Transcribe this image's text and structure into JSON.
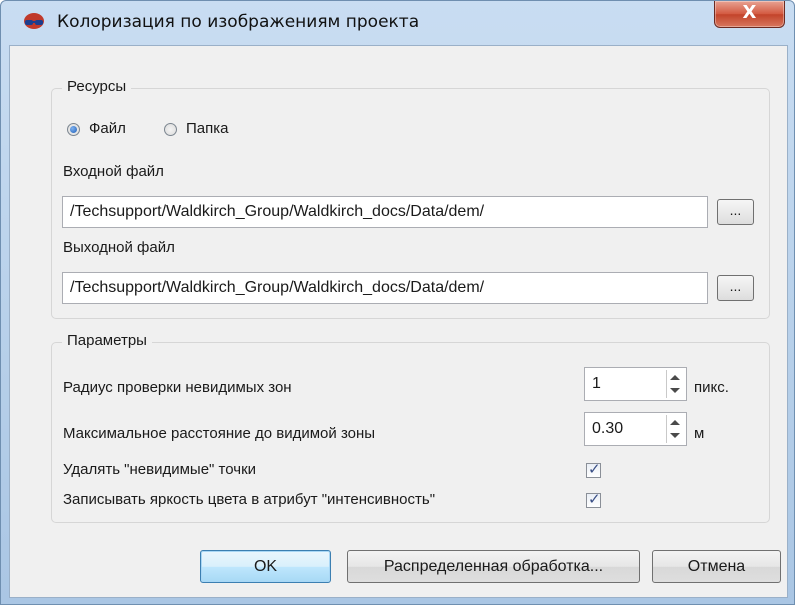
{
  "window": {
    "title": "Колоризация по изображениям проекта",
    "close_label": "X"
  },
  "resources": {
    "group_title": "Ресурсы",
    "radio_file_label": "Файл",
    "radio_folder_label": "Папка",
    "radio_selected": "file",
    "input_file_label": "Входной файл",
    "input_file_value": "/Techsupport/Waldkirch_Group/Waldkirch_docs/Data/dem/",
    "output_file_label": "Выходной файл",
    "output_file_value": "/Techsupport/Waldkirch_Group/Waldkirch_docs/Data/dem/",
    "browse_label": "..."
  },
  "parameters": {
    "group_title": "Параметры",
    "radius_label": "Радиус проверки невидимых зон",
    "radius_value": "1",
    "radius_unit": "пикс.",
    "max_distance_label": "Максимальное расстояние до видимой зоны",
    "max_distance_value": "0.30",
    "max_distance_unit": "м",
    "delete_invisible_label": "Удалять \"невидимые\" точки",
    "delete_invisible_checked": true,
    "write_brightness_label": "Записывать яркость цвета в атрибут \"интенсивность\"",
    "write_brightness_checked": true
  },
  "buttons": {
    "ok": "OK",
    "distributed": "Распределенная обработка...",
    "cancel": "Отмена"
  },
  "icons": {
    "app": "colorization-glasses-icon"
  }
}
